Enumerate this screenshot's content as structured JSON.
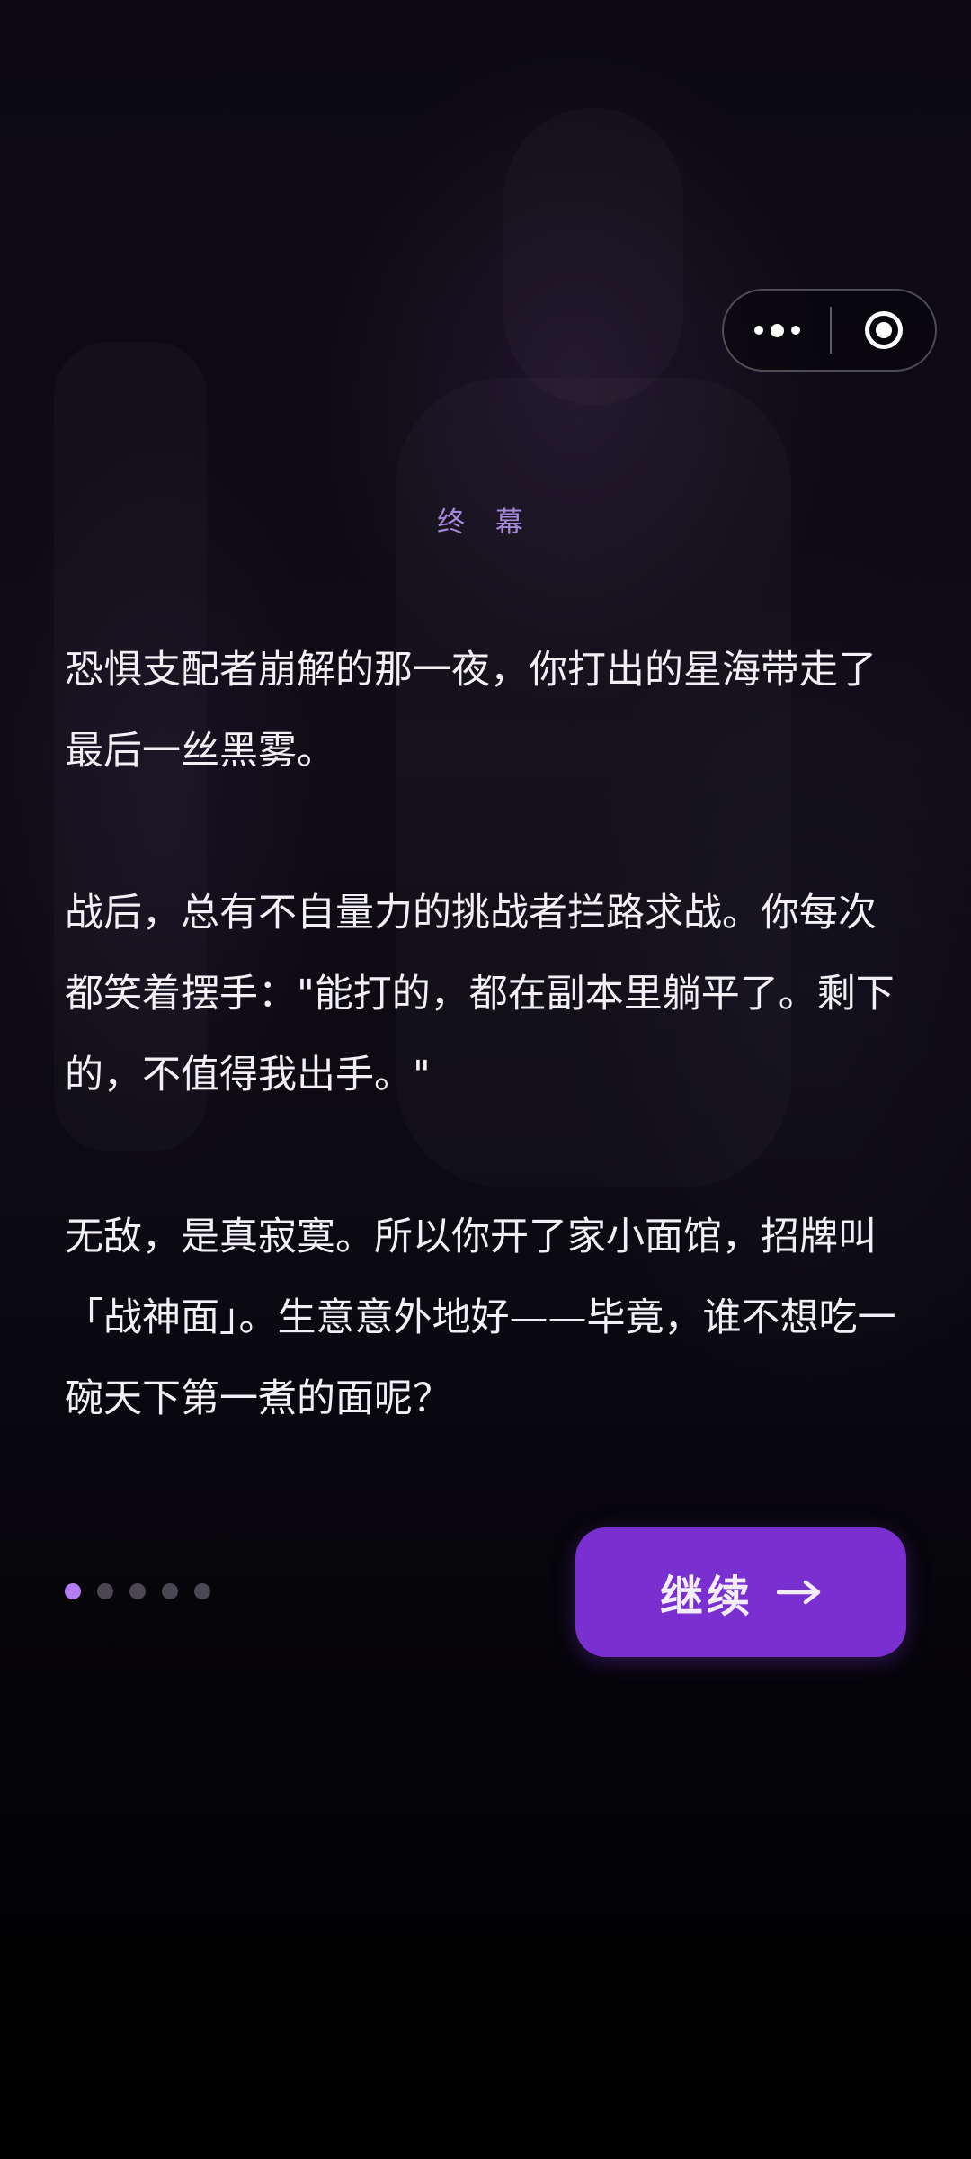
{
  "chapter": {
    "title": "终 幕"
  },
  "story": {
    "paragraphs": [
      "恐惧支配者崩解的那一夜，你打出的星海带走了最后一丝黑雾。",
      "战后，总有不自量力的挑战者拦路求战。你每次都笑着摆手：\"能打的，都在副本里躺平了。剩下的，不值得我出手。\"",
      "无敌，是真寂寞。所以你开了家小面馆，招牌叫「战神面」。生意意外地好——毕竟，谁不想吃一碗天下第一煮的面呢？"
    ]
  },
  "pager": {
    "total": 5,
    "current": 1
  },
  "actions": {
    "continue_label": "继续"
  },
  "capsule": {
    "more_icon": "more-dots-icon",
    "close_icon": "target-circle-icon"
  },
  "colors": {
    "accent": "#7a2fd1",
    "active_dot": "#b47cf0",
    "title": "#a48ad6"
  }
}
